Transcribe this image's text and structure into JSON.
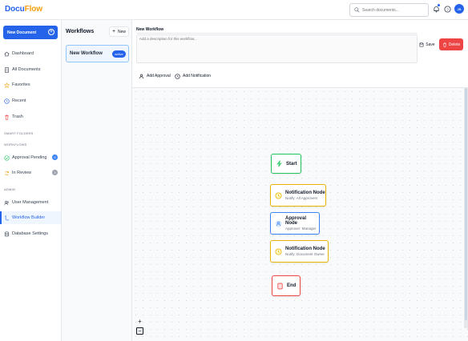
{
  "app": {
    "logo_part1": "Docu",
    "logo_part2": "Flow",
    "search_placeholder": "Search documents...",
    "user_initials": "JS",
    "accent": "#2563eb"
  },
  "sidebar": {
    "new_document": "New Document",
    "items": [
      {
        "label": "Dashboard",
        "icon": "home-icon"
      },
      {
        "label": "All Documents",
        "icon": "documents-icon"
      },
      {
        "label": "Favorites",
        "icon": "star-icon"
      },
      {
        "label": "Recent",
        "icon": "clock-icon"
      },
      {
        "label": "Trash",
        "icon": "trash-icon"
      }
    ],
    "smart_folders_label": "SMART FOLDERS",
    "workflows_label": "WORKFLOWS",
    "workflow_items": [
      {
        "label": "Approval Pending",
        "count": "5",
        "badge_color": "#3b82f6"
      },
      {
        "label": "In Review",
        "count": "3",
        "badge_color": "#9ca3af"
      }
    ],
    "admin_label": "ADMIN",
    "admin_items": [
      {
        "label": "User Management",
        "icon": "users-icon"
      },
      {
        "label": "Workflow Builder",
        "icon": "workflow-icon"
      },
      {
        "label": "Database Settings",
        "icon": "database-icon"
      }
    ]
  },
  "workflows_panel": {
    "title": "Workflows",
    "new_label": "New",
    "items": [
      {
        "name": "New Workflow",
        "status": "active"
      }
    ]
  },
  "editor": {
    "name": "New Workflow",
    "description_placeholder": "Add a description for this workflow...",
    "save_label": "Save",
    "delete_label": "Delete",
    "add_approval": "Add Approval",
    "add_notification": "Add Notification"
  },
  "nodes": {
    "start": {
      "title": "Start"
    },
    "notify1": {
      "title": "Notification Node",
      "subtitle": "Notify: All Approvers"
    },
    "approval": {
      "title": "Approval Node",
      "subtitle": "Approver: Manager"
    },
    "notify2": {
      "title": "Notification Node",
      "subtitle": "Notify: Document Owner"
    },
    "end": {
      "title": "End"
    }
  },
  "canvas_controls": {
    "zoom_in": "+",
    "zoom_out": "−"
  }
}
